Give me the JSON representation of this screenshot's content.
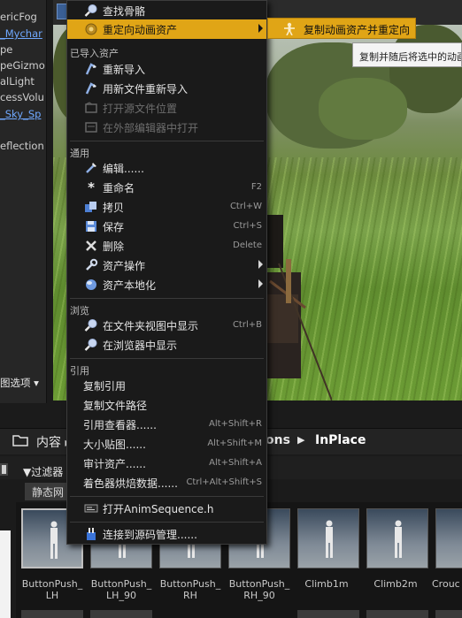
{
  "outliner": {
    "items": [
      {
        "label": "ericFog",
        "link": false
      },
      {
        "label": "_Mychar",
        "link": true
      },
      {
        "label": "pe",
        "link": false
      },
      {
        "label": "peGizmo",
        "link": false
      },
      {
        "label": "alLight",
        "link": false
      },
      {
        "label": "cessVolu",
        "link": false
      },
      {
        "label": "_Sky_Sp",
        "link": true
      },
      {
        "label": "eflection",
        "link": false
      }
    ],
    "view_options": "图选项"
  },
  "context_menu": {
    "top": [
      {
        "label": "查找骨骼",
        "icon": "search-icon"
      },
      {
        "label": "重定向动画资产",
        "icon": "retarget-icon",
        "submenu": true,
        "highlighted": true
      }
    ],
    "imported_section": "已导入资产",
    "imported": [
      {
        "label": "重新导入",
        "icon": "reimport-icon"
      },
      {
        "label": "用新文件重新导入",
        "icon": "reimport-new-file-icon"
      },
      {
        "label": "打开源文件位置",
        "icon": "open-source-location-icon",
        "disabled": true
      },
      {
        "label": "在外部编辑器中打开",
        "icon": "external-editor-icon",
        "disabled": true
      }
    ],
    "general_section": "通用",
    "general": [
      {
        "label": "编辑......",
        "icon": "edit-icon",
        "shortcut": ""
      },
      {
        "label": "重命名",
        "icon": "rename-icon",
        "shortcut": "F2"
      },
      {
        "label": "拷贝",
        "icon": "duplicate-icon",
        "shortcut": "Ctrl+W"
      },
      {
        "label": "保存",
        "icon": "save-icon",
        "shortcut": "Ctrl+S"
      },
      {
        "label": "删除",
        "icon": "delete-icon",
        "shortcut": "Delete"
      },
      {
        "label": "资产操作",
        "icon": "wrench-icon",
        "submenu": true
      },
      {
        "label": "资产本地化",
        "icon": "globe-icon",
        "submenu": true
      }
    ],
    "browse_section": "浏览",
    "browse": [
      {
        "label": "在文件夹视图中显示",
        "icon": "find-in-folder-icon",
        "shortcut": "Ctrl+B"
      },
      {
        "label": "在浏览器中显示",
        "icon": "find-in-browser-icon",
        "shortcut": ""
      }
    ],
    "reference_section": "引用",
    "reference": [
      {
        "label": "复制引用",
        "shortcut": ""
      },
      {
        "label": "复制文件路径",
        "shortcut": ""
      },
      {
        "label": "引用查看器......",
        "shortcut": "Alt+Shift+R"
      },
      {
        "label": "大小贴图......",
        "shortcut": "Alt+Shift+M"
      },
      {
        "label": "审计资产......",
        "shortcut": "Alt+Shift+A"
      },
      {
        "label": "着色器烘焙数据......",
        "shortcut": "Ctrl+Alt+Shift+S"
      }
    ],
    "open_source": {
      "label": "打开AnimSequence.h",
      "icon": "source-code-icon"
    },
    "source_control": {
      "label": "连接到源码管理......",
      "icon": "source-control-icon"
    }
  },
  "submenu": {
    "label": "复制动画资产并重定向",
    "icon": "retarget-duplicate-icon"
  },
  "tooltip": {
    "text": "复制并随后将选中的动画"
  },
  "content_browser": {
    "path": {
      "root": "内容",
      "parent": "ons",
      "current": "InPlace"
    },
    "filter_label": "过滤器",
    "static_tab": "静态网",
    "assets": [
      {
        "name": "ButtonPush_\nLH",
        "selected": true
      },
      {
        "name": "ButtonPush_\nLH_90",
        "selected": false
      },
      {
        "name": "ButtonPush_\nRH",
        "selected": false
      },
      {
        "name": "ButtonPush_\nRH_90",
        "selected": false
      },
      {
        "name": "Climb1m",
        "selected": false
      },
      {
        "name": "Climb2m",
        "selected": false
      },
      {
        "name": "Crouc",
        "selected": false
      }
    ]
  }
}
